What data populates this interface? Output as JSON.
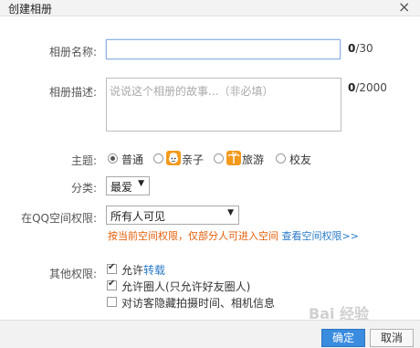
{
  "dialog": {
    "title": "创建相册",
    "close_glyph": "×"
  },
  "form": {
    "name": {
      "label": "相册名称:",
      "value": "",
      "count": "0",
      "max": "/30"
    },
    "desc": {
      "label": "相册描述:",
      "placeholder": "说说这个相册的故事...（非必填）",
      "count": "0",
      "max": "/2000"
    },
    "theme": {
      "label": "主题:",
      "options": [
        {
          "label": "普通",
          "selected": true
        },
        {
          "label": "亲子",
          "selected": false,
          "icon": "child-face-icon"
        },
        {
          "label": "旅游",
          "selected": false,
          "icon": "palm-tree-icon"
        },
        {
          "label": "校友",
          "selected": false
        }
      ]
    },
    "category": {
      "label": "分类:",
      "value": "最爱"
    },
    "permission": {
      "label": "在QQ空间权限:",
      "value": "所有人可见",
      "note": "按当前空间权限，仅部分人可进入空间",
      "link": "查看空间权限>>"
    },
    "other": {
      "label": "其他权限:",
      "options": [
        {
          "prefix": "允许",
          "link": "转载",
          "checked": true
        },
        {
          "prefix": "允许圈人(只允许好友圈人)",
          "link": "",
          "checked": true
        },
        {
          "prefix": "对访客隐藏拍摄时间、相机信息",
          "link": "",
          "checked": false
        }
      ]
    }
  },
  "footer": {
    "ok_label": "确定",
    "cancel_label": "取消"
  },
  "colors": {
    "accent": "#3a8cdf",
    "warning": "#e35f0a",
    "link": "#2a7ac7",
    "badge": "#f39a1c"
  },
  "watermark": "Bai 经验"
}
